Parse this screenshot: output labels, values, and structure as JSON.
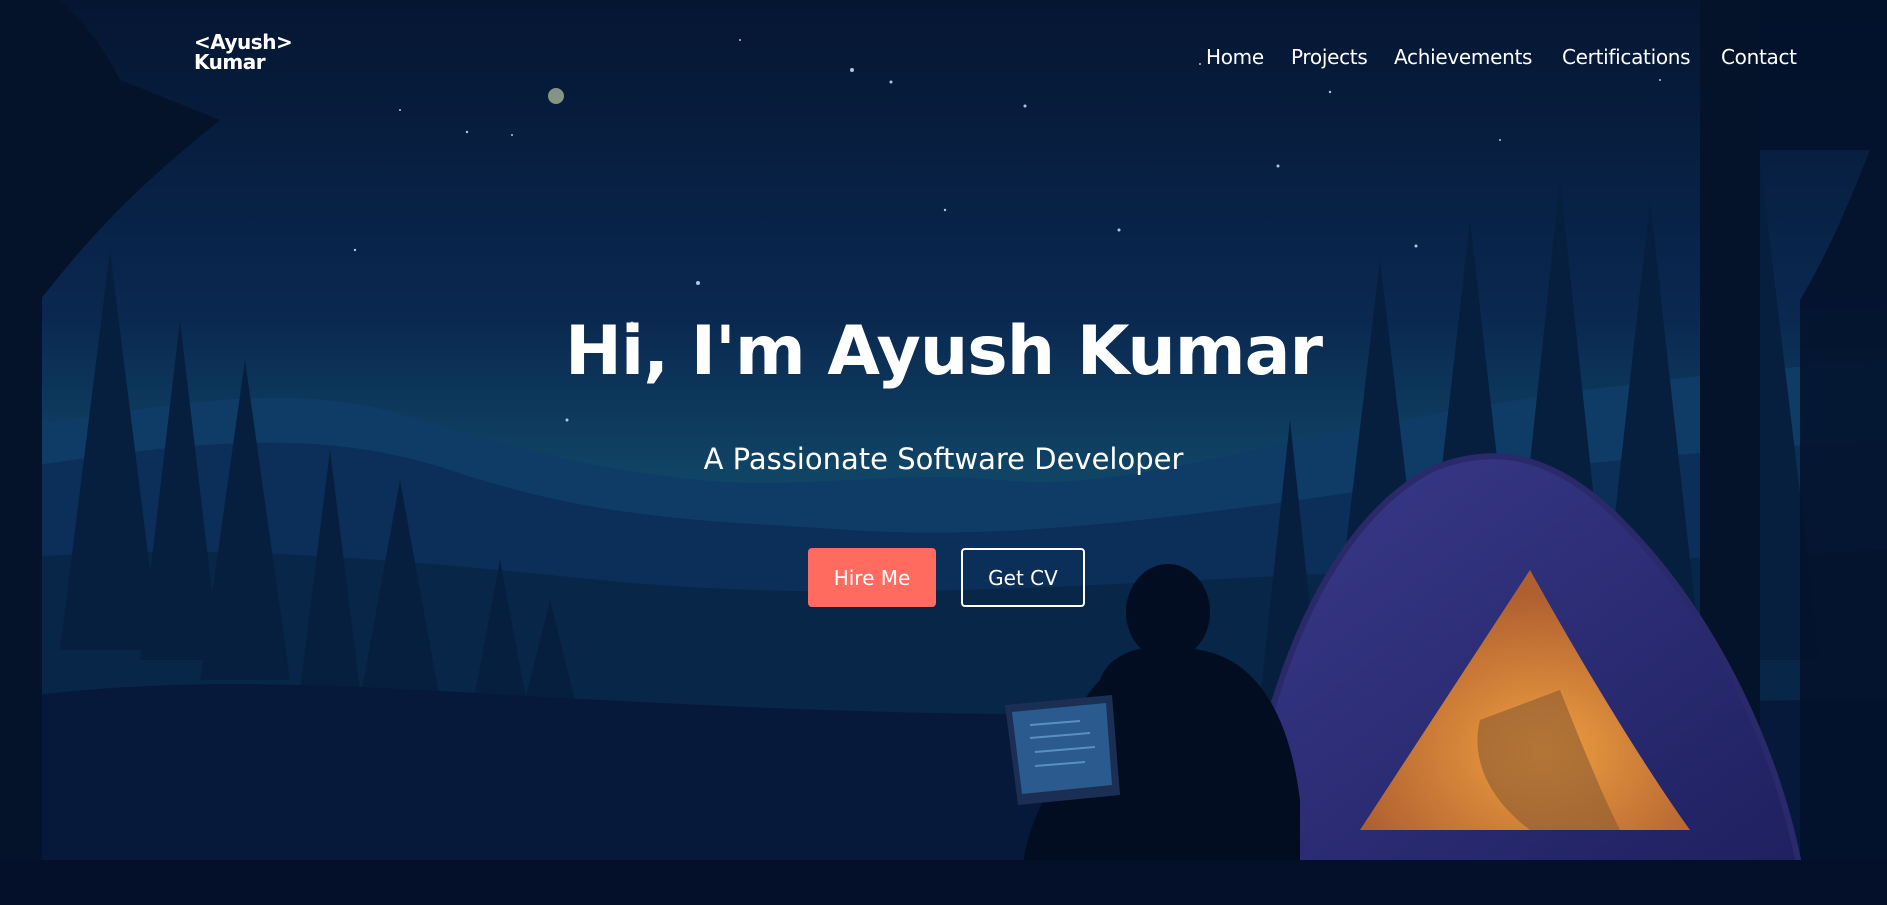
{
  "brand": {
    "line1": "<Ayush>",
    "line2": "Kumar"
  },
  "nav": {
    "items": [
      "Home",
      "Projects",
      "Achievements",
      "Certifications",
      "Contact"
    ]
  },
  "hero": {
    "title": "Hi, I'm Ayush Kumar",
    "subtitle": "A Passionate Software Developer",
    "primary_button": "Hire Me",
    "secondary_button": "Get CV"
  },
  "colors": {
    "accent": "#ff6b5e",
    "sky_top": "#061735",
    "sky_horizon": "#12506e",
    "tent_glow": "#e8963a"
  }
}
